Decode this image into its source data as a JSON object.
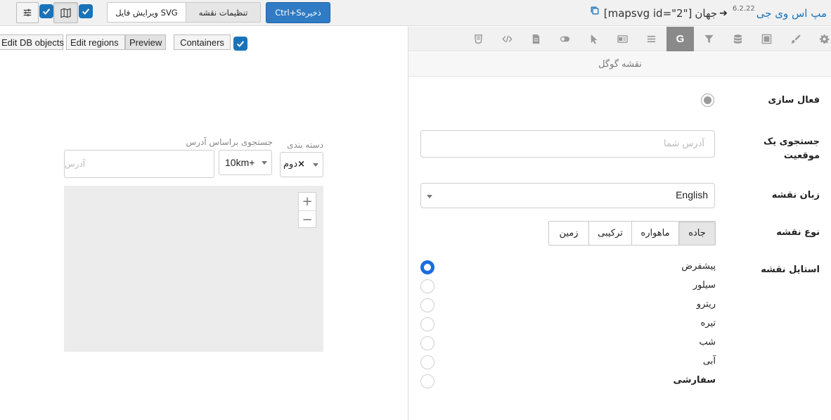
{
  "toolbar": {
    "title_app": "مپ اس وی جی",
    "version": "6.2.22",
    "breadcrumb_map": "جهان",
    "shortcode": "[mapsvg id=\"2\"]",
    "save_label": "ذخیره",
    "save_shortcut": "Ctrl+S",
    "mode_tabs": [
      "تنظیمات نقشه",
      "ویرایش فایل SVG"
    ],
    "active_mode_tab": 0,
    "accent_color": "#1a73b8"
  },
  "preview": {
    "buttons": [
      "Edit DB objects",
      "Edit regions",
      "Preview"
    ],
    "active_button": "Preview",
    "containers_label": "Containers",
    "category_label": "دسته بندی",
    "category_value": "دوم",
    "search_label": "جستجوی براساس آدرس",
    "search_placeholder": "آدرس",
    "distance_value": "10km+"
  },
  "settings": {
    "section_title": "نقشه گوگل",
    "active_tab_icon": "google-g-icon",
    "enable_label": "فعال سازی",
    "search_location_label": "جستجوی یک موقعیت",
    "search_location_placeholder": "آدرس شما",
    "language_label": "زبان نقشه",
    "language_value": "English",
    "map_type_label": "نوع نقشه",
    "map_types": [
      "جاده",
      "ماهواره",
      "ترکیبی",
      "زمین"
    ],
    "active_map_type": "جاده",
    "map_style_label": "استایل نقشه",
    "styles": [
      "پیشفرض",
      "سیلور",
      "ریترو",
      "تیره",
      "شب",
      "آبی",
      "سفارشی"
    ],
    "selected_style": "پیشفرض"
  }
}
